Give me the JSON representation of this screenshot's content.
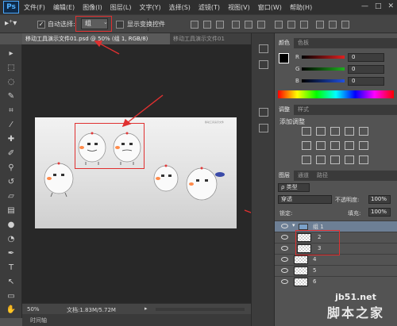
{
  "app": {
    "logo": "Ps"
  },
  "menu": [
    "文件(F)",
    "编辑(E)",
    "图像(I)",
    "图层(L)",
    "文字(Y)",
    "选择(S)",
    "滤镜(T)",
    "视图(V)",
    "窗口(W)",
    "帮助(H)"
  ],
  "window_controls": [
    "—",
    "□",
    "✕"
  ],
  "options": {
    "auto_select_label": "自动选择:",
    "auto_select_checked": true,
    "auto_select_value": "组",
    "show_transform_label": "显示变换控件"
  },
  "tabs": {
    "active": "移动工具演示文件01.psd @ 50% (组 1, RGB/8)",
    "inactive": "移动工具演示文件01"
  },
  "canvas": {
    "caption": "移动工具演示文件"
  },
  "status": {
    "zoom": "50%",
    "doc": "文档:1.83M/5.72M"
  },
  "timeline": "时间轴",
  "color_panel": {
    "tabs": [
      "颜色",
      "色板"
    ],
    "channels": [
      {
        "label": "R",
        "value": "0",
        "color": "#e02020"
      },
      {
        "label": "G",
        "value": "0",
        "color": "#20b020"
      },
      {
        "label": "B",
        "value": "0",
        "color": "#2050e0"
      }
    ]
  },
  "adjustments_panel": {
    "tabs": [
      "调整",
      "样式"
    ],
    "title": "添加调整"
  },
  "layers_panel": {
    "tabs": [
      "图层",
      "通道",
      "路径"
    ],
    "filter_kind": "ρ 类型",
    "blend_mode": "穿透",
    "opacity_label": "不透明度:",
    "opacity_value": "100%",
    "lock_label": "锁定:",
    "fill_label": "填充:",
    "fill_value": "100%",
    "group_name": "组 1",
    "layers": [
      "2",
      "3",
      "4",
      "5",
      "6"
    ]
  },
  "watermark": {
    "line1": "jb51.net",
    "line2": "脚本之家"
  },
  "accent": {
    "highlight": "#e03030",
    "ps_blue": "#4fb0ff"
  }
}
